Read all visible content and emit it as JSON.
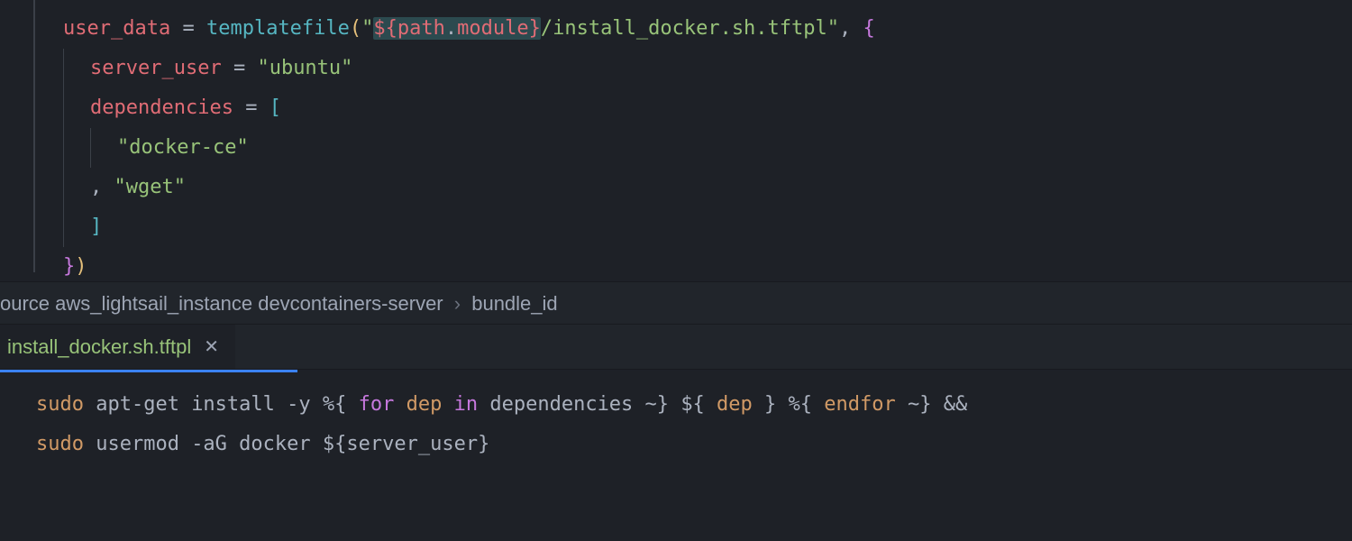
{
  "top": {
    "l1": {
      "prop": "user_data",
      "eq": " = ",
      "fn": "templatefile",
      "open": "(",
      "q1": "\"",
      "interp_open": "${",
      "path": "path",
      "dot": ".",
      "module": "module",
      "interp_close": "}",
      "rest": "/install_docker.sh.tftpl",
      "q2": "\"",
      "comma": ", ",
      "brace": "{"
    },
    "l2": {
      "prop": "server_user",
      "eq": " = ",
      "val": "\"ubuntu\""
    },
    "l3": {
      "prop": "dependencies",
      "eq": " = ",
      "open": "["
    },
    "l4": {
      "val": "\"docker-ce\""
    },
    "l5": {
      "comma": ", ",
      "val": "\"wget\""
    },
    "l6": {
      "close": "]"
    },
    "l7": {
      "brace_close": "}",
      "paren_close": ")"
    }
  },
  "breadcrumb": {
    "a": "ource",
    "b": "aws_lightsail_instance",
    "c": "devcontainers-server",
    "d": "bundle_id"
  },
  "tab": {
    "name": "install_docker.sh.tftpl"
  },
  "bottom": {
    "l1": {
      "sudo": "sudo",
      "s1": " apt-get install -y ",
      "d1": "%{",
      "for": " for ",
      "dep": "dep",
      "in": " in ",
      "deps": "dependencies",
      "tilde1": " ~}",
      "sp1": " ",
      "d2": "${",
      "depv": " dep ",
      "cb1": "}",
      "sp2": " ",
      "d3": "%{",
      "endfor": " endfor ",
      "tilde2": "~}",
      "amp": " &&"
    },
    "l2": {
      "sudo": "sudo",
      "s1": " usermod -aG docker ",
      "d1": "${",
      "var": "server_user",
      "cb": "}"
    }
  }
}
